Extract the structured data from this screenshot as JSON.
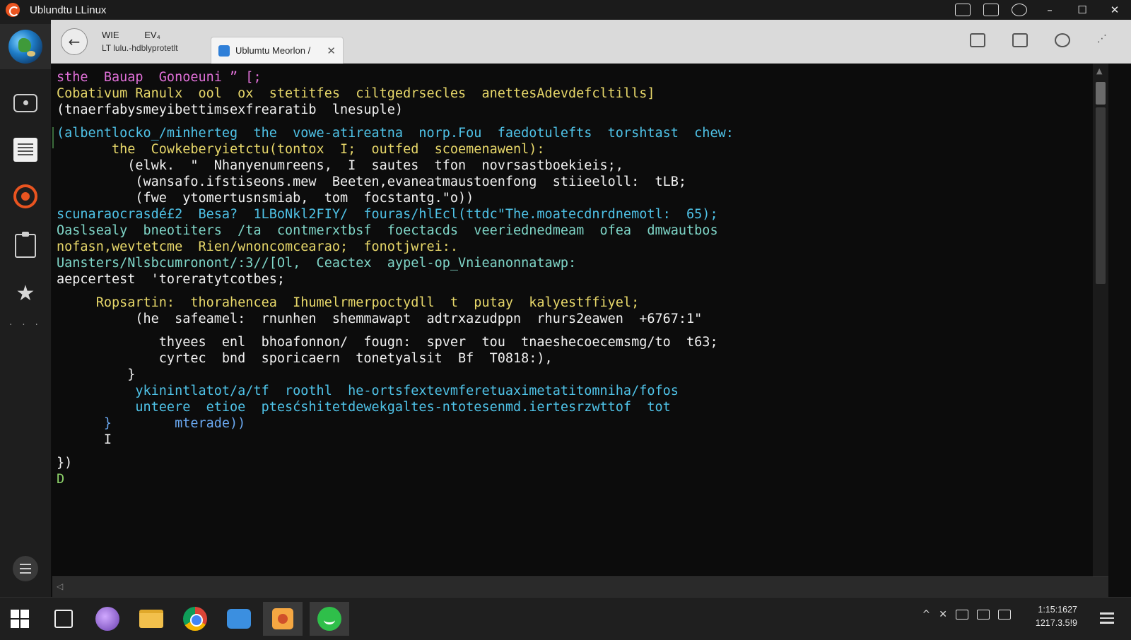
{
  "window": {
    "title": "Ublundtu LLinux",
    "controls": {
      "minimize": "–",
      "maximize": "☐",
      "close": "✕"
    },
    "titlebar_icons": [
      "pdf-icon",
      "news-icon",
      "globe-icon"
    ]
  },
  "sidebar": {
    "items": [
      "globe-icon",
      "camera-icon",
      "document-icon",
      "ubuntu-icon",
      "clipboard-icon",
      "star-icon",
      "dots-icon",
      "menu-icon"
    ]
  },
  "toolbar": {
    "back_label": "←",
    "labels_row1": [
      "WIE",
      "EV₄"
    ],
    "labels_row2": "LT lulu.-hdblyprotetlt",
    "tab": {
      "label": "Ublumtu Meorlon /",
      "close": "✕"
    },
    "right_icons": [
      "save-icon",
      "trash-icon",
      "circle-icon",
      "more-icon"
    ]
  },
  "terminal": {
    "lines": [
      {
        "text": "sthe  Bauap  Gonoeuni ” [;",
        "color": "mag",
        "indent": ""
      },
      {
        "text": "Cobativum Ranulx  ool  ox  stetitfes  ciltgedrsecles  anettesAdevdefcltills]",
        "color": "yel",
        "indent": ""
      },
      {
        "text": "(tnaerfabysmeyibettimsexfrearatib  lnesuplе)",
        "color": "wht",
        "indent": ""
      },
      {
        "text": "",
        "color": "wht",
        "indent": ""
      },
      {
        "text": "(albentlocko_/minherteg  the  vowe-atireatna  norp.Fou  faedotulefts  torshtast  chew:",
        "color": "cya",
        "indent": ""
      },
      {
        "text": "the  Cowkeberyietctu(tontox  I;  outfed  scoemenawenl):",
        "color": "yel",
        "indent": "       "
      },
      {
        "text": "(elwk.  \"  Nhanyenumreens,  I  sautes  tfon  novrsastboekieis;,",
        "color": "wht",
        "indent": "         "
      },
      {
        "text": "(wansafo.ifstiseons.mew  Beeten,evaneatmaustoenfong  stiieeloll:  tLB;",
        "color": "wht",
        "indent": "          "
      },
      {
        "text": "(fwe  ytomertusnsmiab,  tom  focstantg.\"o))",
        "color": "wht",
        "indent": "          "
      },
      {
        "text": "scunaraocrasdé£2  Besa?  1LBoNkl2FIY/  fouras/hlEcl(ttdc\"The.moatecdnrdnemotl:  65);",
        "color": "cya",
        "indent": ""
      },
      {
        "text": "Oaslsealy  bneotiters  /ta  contmerxtbsf  foectacds  veeriednedmeam  ofea  dmwautbos",
        "color": "tea",
        "indent": ""
      },
      {
        "text": "nofasn,wevtetcme  Rien/wnoncomcearao;  fonotjwrei:.",
        "color": "yel",
        "indent": ""
      },
      {
        "text": "Uansters/Nlsbcumronont/:3//[Ol,  Ceactex  aypel-op_Vnieanonnatawp:",
        "color": "tea",
        "indent": ""
      },
      {
        "text": "aepcertest  'toreratytcotbes;",
        "color": "wht",
        "indent": ""
      },
      {
        "text": "",
        "color": "wht",
        "indent": ""
      },
      {
        "text": "Ropsartin:  thorahencea  Ihumelrmerpoctydll  t  putay  kalyestffiyel;",
        "color": "yel",
        "indent": "     "
      },
      {
        "text": "(he  safeamel:  rnunhen  shemmawapt  adtrxazudppn  rhurs2eawen  +6767:1\"",
        "color": "wht",
        "indent": "          "
      },
      {
        "text": "",
        "color": "wht",
        "indent": ""
      },
      {
        "text": "thyees  enl  bhoafonnon/  fougn:  spver  tou  tnaeshecoecemsmg/to  t63;",
        "color": "wht",
        "indent": "             "
      },
      {
        "text": "cyrtec  bnd  sporicaern  tonetyalsit  Bf  T0818:),",
        "color": "wht",
        "indent": "             "
      },
      {
        "text": "}",
        "color": "wht",
        "indent": "         "
      },
      {
        "text": "ykinintlatot/a/tf  roothl  he-ortsfextevmferetuaximetatitomniha/fofos",
        "color": "cya",
        "indent": "          "
      },
      {
        "text": "unteere  etioe  ptesćshitetdewekgaltes-ntotesenmd.iertesrzwttof  tot",
        "color": "cya",
        "indent": "          "
      },
      {
        "text": "}        mterade))",
        "color": "blu",
        "indent": "      "
      },
      {
        "text": "I",
        "color": "wht",
        "indent": "      "
      },
      {
        "text": "",
        "color": "wht",
        "indent": ""
      },
      {
        "text": "})",
        "color": "wht",
        "indent": ""
      },
      {
        "text": "D",
        "color": "grn",
        "indent": ""
      }
    ]
  },
  "taskbar": {
    "apps": [
      "windows-start-icon",
      "file-icon",
      "app-purple-icon",
      "folder-icon",
      "chrome-icon",
      "mail-icon",
      "app-orange-icon",
      "whatsapp-icon"
    ],
    "tray": [
      "^",
      "✕"
    ],
    "clock": {
      "time": "1:15:1627",
      "date": "1217.3.5!9"
    }
  }
}
